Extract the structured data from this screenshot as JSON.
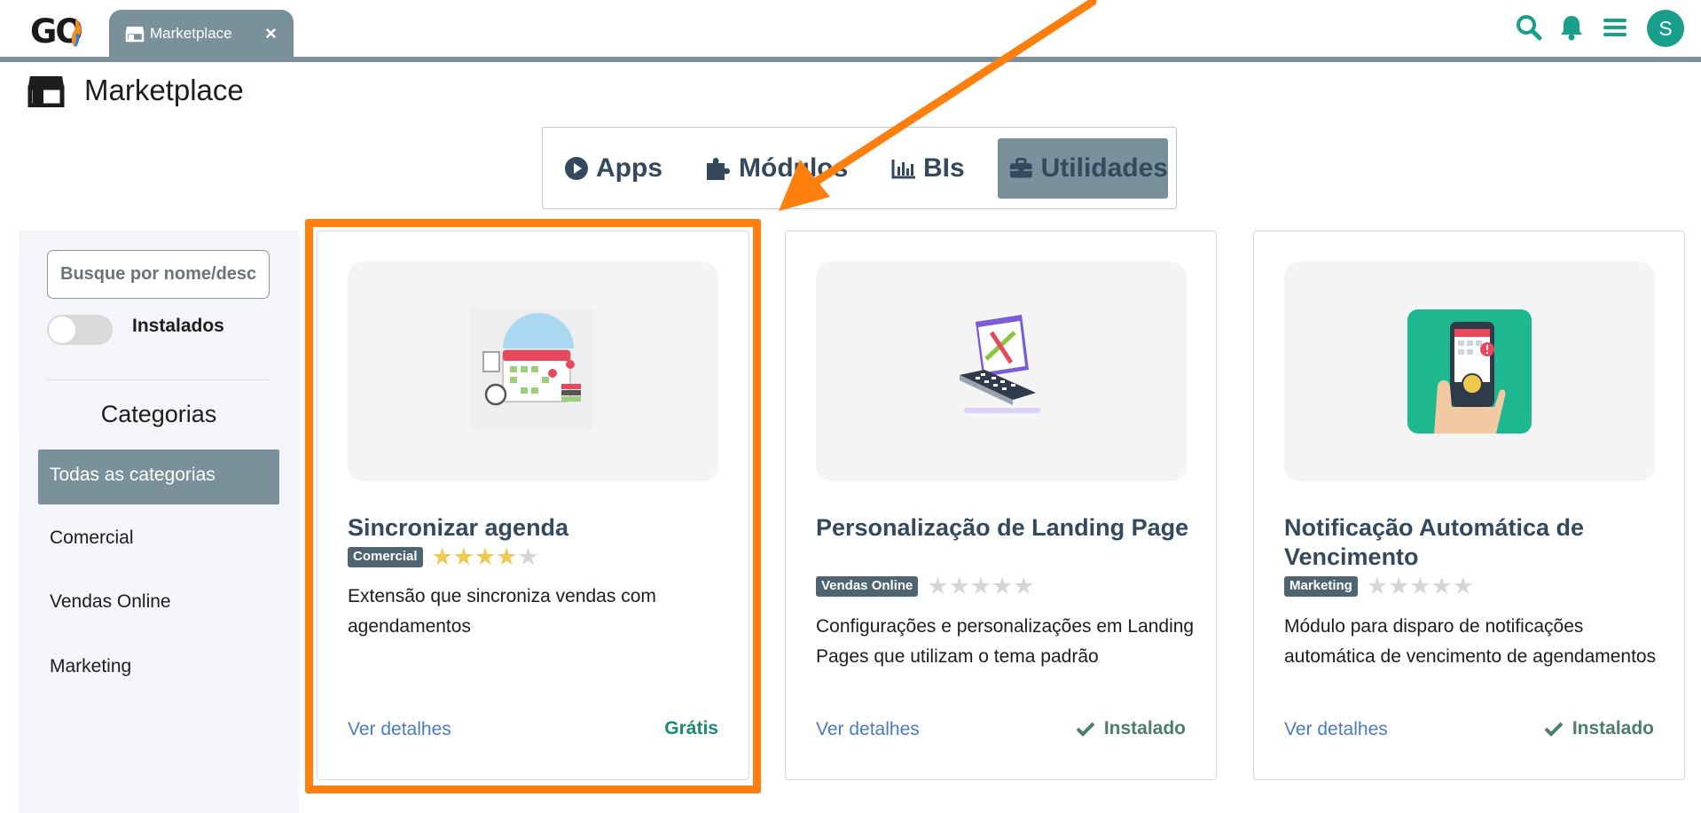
{
  "app": {
    "logo": "GO",
    "tab": {
      "label": "Marketplace",
      "close": "×"
    }
  },
  "header": {
    "icons": [
      "search-icon",
      "bell-icon",
      "menu-icon"
    ],
    "avatar_initial": "S"
  },
  "page": {
    "title": "Marketplace"
  },
  "tabs": [
    {
      "label": "Apps",
      "icon": "play-icon",
      "active": false
    },
    {
      "label": "Módulos",
      "icon": "puzzle-icon",
      "active": false
    },
    {
      "label": "BIs",
      "icon": "bar-chart-icon",
      "active": false
    },
    {
      "label": "Utilidades",
      "icon": "toolbox-icon",
      "active": true
    }
  ],
  "sidebar": {
    "search_placeholder": "Busque por nome/descrição",
    "toggle_label": "Instalados",
    "categories_title": "Categorias",
    "categories": [
      {
        "label": "Todas as categorias",
        "active": true
      },
      {
        "label": "Comercial",
        "active": false
      },
      {
        "label": "Vendas Online",
        "active": false
      },
      {
        "label": "Marketing",
        "active": false
      }
    ]
  },
  "cards": [
    {
      "title": "Sincronizar agenda",
      "badge": "Comercial",
      "rating": 4,
      "description": "Extensão que sincroniza vendas com agendamentos",
      "link": "Ver detalhes",
      "status": "Grátis",
      "installed": false
    },
    {
      "title": "Personalização de Landing Page",
      "badge": "Vendas Online",
      "rating": 0,
      "description": "Configurações e personalizações em Landing Pages que utilizam o tema padrão",
      "link": "Ver detalhes",
      "status": "Instalado",
      "installed": true
    },
    {
      "title": "Notificação Automática de Vencimento",
      "badge": "Marketing",
      "rating": 0,
      "description": "Módulo para disparo de notificações automática de vencimento de agendamentos",
      "link": "Ver detalhes",
      "status": "Instalado",
      "installed": true
    }
  ],
  "colors": {
    "accent_gray": "#7a909b",
    "teal": "#1a9e8c",
    "title_navy": "#34495e",
    "link_blue": "#4b7bbf",
    "annotation_orange": "#ff7f0e",
    "star_gold": "#f2c94c"
  }
}
